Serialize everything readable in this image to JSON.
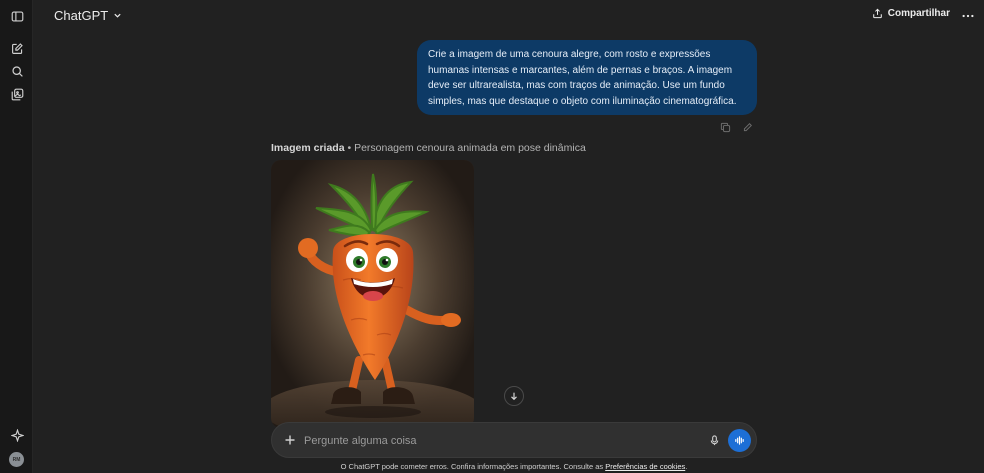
{
  "header": {
    "model_name": "ChatGPT",
    "share_label": "Compartilhar"
  },
  "sidebar": {
    "avatar_initials": "RM"
  },
  "conversation": {
    "user_message": "Crie a imagem de uma cenoura alegre, com rosto e expressões humanas intensas e marcantes, além de pernas e braços. A imagem deve ser ultrarealista, mas com traços de animação. Use um fundo simples, mas que destaque o objeto com iluminação cinematográfica.",
    "image_caption_title": "Imagem criada",
    "image_caption_separator": " • ",
    "image_caption_desc": "Personagem cenoura animada em pose dinâmica"
  },
  "composer": {
    "placeholder": "Pergunte alguma coisa"
  },
  "footer": {
    "note": "O ChatGPT pode cometer erros. Confira informações importantes. Consulte as ",
    "link": "Preferências de cookies",
    "end": "."
  },
  "colors": {
    "background": "#212121",
    "user_bubble": "#0d3a66",
    "accent": "#1d6fd6"
  },
  "icons": [
    "sidebar-toggle-icon",
    "new-chat-icon",
    "search-icon",
    "library-icon",
    "sparkle-icon",
    "chevron-down-icon",
    "share-icon",
    "more-icon",
    "copy-icon",
    "edit-icon",
    "arrow-down-icon",
    "plus-icon",
    "mic-icon",
    "voice-wave-icon"
  ]
}
